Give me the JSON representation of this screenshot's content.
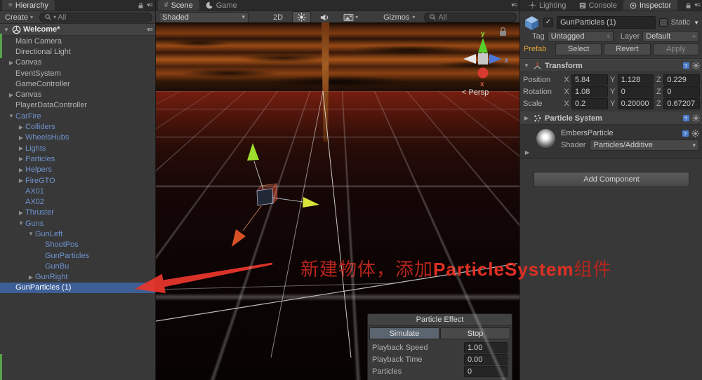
{
  "colors": {
    "selection_blue": "#3d5f96",
    "prefab_text": "#6e93cf",
    "annotation_red": "#e03024",
    "prefab_label_orange": "#dfa33a",
    "accent_sky_orange": "#aa5418"
  },
  "icons": {
    "foldout_expanded": "▼",
    "foldout_collapsed": "▶",
    "dropdown_caret": "▾",
    "menu": "≡",
    "updown": "÷",
    "check": "✓",
    "hash": "#"
  },
  "hierarchy": {
    "tab_label": "Hierarchy",
    "create_label": "Create",
    "search_text": "All",
    "scene_name": "Welcome*",
    "items": [
      {
        "label": "Main Camera",
        "level": 0,
        "arrow": "none",
        "prefab": false,
        "selected": false
      },
      {
        "label": "Directional Light",
        "level": 0,
        "arrow": "none",
        "prefab": false,
        "selected": false
      },
      {
        "label": "Canvas",
        "level": 0,
        "arrow": "collapsed",
        "prefab": false,
        "selected": false
      },
      {
        "label": "EventSystem",
        "level": 0,
        "arrow": "none",
        "prefab": false,
        "selected": false
      },
      {
        "label": "GameController",
        "level": 0,
        "arrow": "none",
        "prefab": false,
        "selected": false
      },
      {
        "label": "Canvas",
        "level": 0,
        "arrow": "collapsed",
        "prefab": false,
        "selected": false
      },
      {
        "label": "PlayerDataController",
        "level": 0,
        "arrow": "none",
        "prefab": false,
        "selected": false
      },
      {
        "label": "CarFire",
        "level": 0,
        "arrow": "expanded",
        "prefab": true,
        "selected": false
      },
      {
        "label": "Colliders",
        "level": 1,
        "arrow": "collapsed",
        "prefab": true,
        "selected": false
      },
      {
        "label": "WheelsHubs",
        "level": 1,
        "arrow": "collapsed",
        "prefab": true,
        "selected": false
      },
      {
        "label": "Lights",
        "level": 1,
        "arrow": "collapsed",
        "prefab": true,
        "selected": false
      },
      {
        "label": "Particles",
        "level": 1,
        "arrow": "collapsed",
        "prefab": true,
        "selected": false
      },
      {
        "label": "Helpers",
        "level": 1,
        "arrow": "collapsed",
        "prefab": true,
        "selected": false
      },
      {
        "label": "FireGTO",
        "level": 1,
        "arrow": "collapsed",
        "prefab": true,
        "selected": false
      },
      {
        "label": "AX01",
        "level": 1,
        "arrow": "none",
        "prefab": true,
        "selected": false
      },
      {
        "label": "AX02",
        "level": 1,
        "arrow": "none",
        "prefab": true,
        "selected": false
      },
      {
        "label": "Thruster",
        "level": 1,
        "arrow": "collapsed",
        "prefab": true,
        "selected": false
      },
      {
        "label": "Guns",
        "level": 1,
        "arrow": "expanded",
        "prefab": true,
        "selected": false
      },
      {
        "label": "GunLeft",
        "level": 2,
        "arrow": "expanded",
        "prefab": true,
        "selected": false
      },
      {
        "label": "ShootPos",
        "level": 3,
        "arrow": "none",
        "prefab": true,
        "selected": false
      },
      {
        "label": "GunParticles",
        "level": 3,
        "arrow": "none",
        "prefab": true,
        "selected": false
      },
      {
        "label": "GunBu",
        "level": 3,
        "arrow": "none",
        "prefab": true,
        "selected": false
      },
      {
        "label": "GunRight",
        "level": 2,
        "arrow": "collapsed",
        "prefab": true,
        "selected": false
      },
      {
        "label": "GunParticles (1)",
        "level": 0,
        "arrow": "none",
        "prefab": false,
        "selected": true
      }
    ]
  },
  "scene_view": {
    "tab_scene": "Scene",
    "tab_game": "Game",
    "toolbar": {
      "shaded_label": "Shaded",
      "mode_2d_label": "2D",
      "gizmos_label": "Gizmos",
      "search_text": "All"
    },
    "persp_label": "< Persp",
    "axis": {
      "x": "x",
      "y": "y",
      "z": "z"
    }
  },
  "particle_effect": {
    "title": "Particle Effect",
    "simulate_label": "Simulate",
    "stop_label": "Stop",
    "rows": [
      {
        "label": "Playback Speed",
        "value": "1.00"
      },
      {
        "label": "Playback Time",
        "value": "0.00"
      },
      {
        "label": "Particles",
        "value": "0"
      }
    ]
  },
  "top_tabs": {
    "lighting": "Lighting",
    "console": "Console",
    "inspector": "Inspector"
  },
  "inspector": {
    "name": "GunParticles (1)",
    "static_label": "Static",
    "tag_label": "Tag",
    "tag_value": "Untagged",
    "layer_label": "Layer",
    "layer_value": "Default",
    "prefab_label": "Prefab",
    "select_label": "Select",
    "revert_label": "Revert",
    "apply_label": "Apply",
    "axes": [
      "X",
      "Y",
      "Z"
    ],
    "transform": {
      "title": "Transform",
      "rows": [
        {
          "label": "Position",
          "x": "5.84",
          "y": "1.128",
          "z": "0.229"
        },
        {
          "label": "Rotation",
          "x": "1.08",
          "y": "0",
          "z": "0"
        },
        {
          "label": "Scale",
          "x": "0.2",
          "y": "0.20000",
          "z": "0.67207"
        }
      ]
    },
    "particle_system_title": "Particle System",
    "material": {
      "name": "EmbersParticle",
      "shader_label": "Shader",
      "shader_value": "Particles/Additive"
    },
    "add_component_label": "Add Component"
  },
  "annotation": {
    "parts": [
      "新建物体，添加",
      "ParticleSystem",
      "组件"
    ]
  }
}
